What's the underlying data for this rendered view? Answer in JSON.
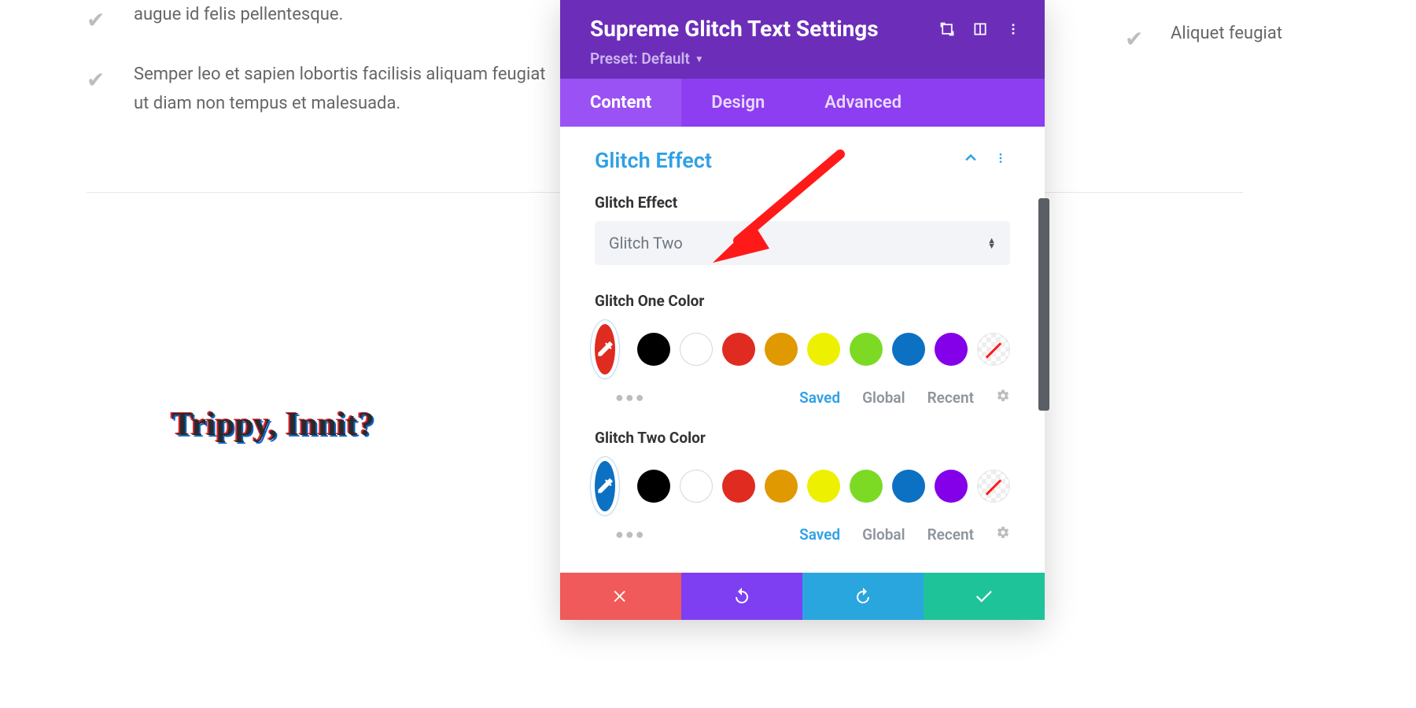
{
  "background": {
    "list_items": [
      "augue id felis pellentesque.",
      "Semper leo et sapien lobortis facilisis aliquam feugiat ut diam non tempus et malesuada."
    ],
    "right_item": "Aliquet feugiat",
    "glitch_preview_text": "Trippy, Innit?"
  },
  "panel": {
    "title": "Supreme Glitch Text Settings",
    "preset_label": "Preset: Default",
    "tabs": {
      "content": "Content",
      "design": "Design",
      "advanced": "Advanced"
    },
    "section": {
      "title": "Glitch Effect",
      "effect_label": "Glitch Effect",
      "effect_value": "Glitch Two",
      "color_one_label": "Glitch One Color",
      "color_two_label": "Glitch Two Color",
      "palette_tabs": {
        "saved": "Saved",
        "global": "Global",
        "recent": "Recent"
      }
    },
    "colors": {
      "eyedrop_one": "#e02b20",
      "eyedrop_two": "#0c71c3",
      "swatches": [
        "#000000",
        "#ffffff",
        "#e02b20",
        "#e09900",
        "#edf000",
        "#7cda24",
        "#0c71c3",
        "#8300e9",
        "transparent"
      ]
    }
  }
}
